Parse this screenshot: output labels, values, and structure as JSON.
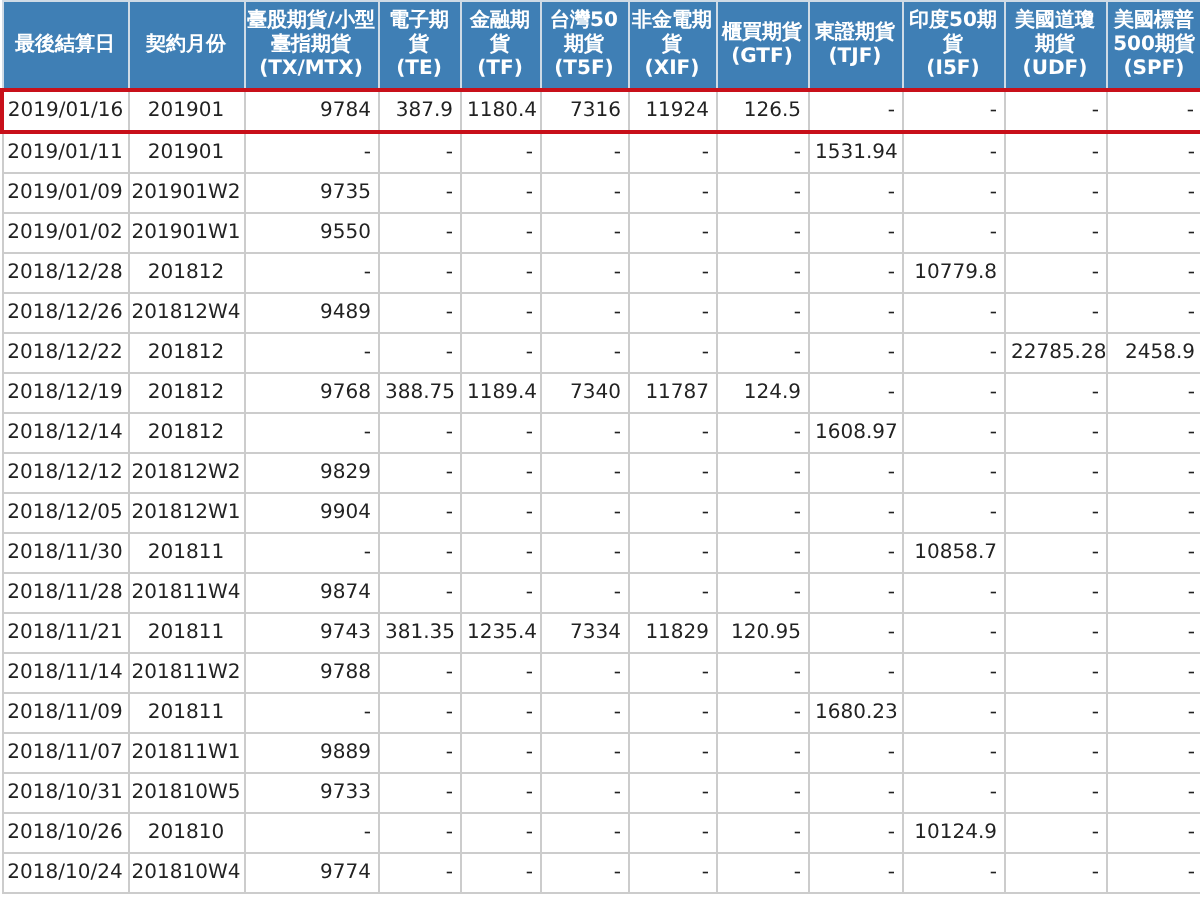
{
  "table": {
    "columns": [
      {
        "name": "最後結算日"
      },
      {
        "name": "契約月份"
      },
      {
        "name": "臺股期貨/小型臺指期貨",
        "code": "(TX/MTX)"
      },
      {
        "name": "電子期貨",
        "code": "(TE)"
      },
      {
        "name": "金融期貨",
        "code": "(TF)"
      },
      {
        "name": "台灣50期貨",
        "code": "(T5F)"
      },
      {
        "name": "非金電期貨",
        "code": "(XIF)"
      },
      {
        "name": "櫃買期貨",
        "code": "(GTF)"
      },
      {
        "name": "東證期貨",
        "code": "(TJF)"
      },
      {
        "name": "印度50期貨",
        "code": "(I5F)"
      },
      {
        "name": "美國道瓊期貨",
        "code": "(UDF)"
      },
      {
        "name": "美國標普500期貨",
        "code": "(SPF)"
      }
    ],
    "rows": [
      {
        "selected": true,
        "cells": [
          "2019/01/16",
          "201901",
          "9784",
          "387.9",
          "1180.4",
          "7316",
          "11924",
          "126.5",
          "-",
          "-",
          "-",
          "-"
        ]
      },
      {
        "selected": false,
        "cells": [
          "2019/01/11",
          "201901",
          "-",
          "-",
          "-",
          "-",
          "-",
          "-",
          "1531.94",
          "-",
          "-",
          "-"
        ]
      },
      {
        "selected": false,
        "cells": [
          "2019/01/09",
          "201901W2",
          "9735",
          "-",
          "-",
          "-",
          "-",
          "-",
          "-",
          "-",
          "-",
          "-"
        ]
      },
      {
        "selected": false,
        "cells": [
          "2019/01/02",
          "201901W1",
          "9550",
          "-",
          "-",
          "-",
          "-",
          "-",
          "-",
          "-",
          "-",
          "-"
        ]
      },
      {
        "selected": false,
        "cells": [
          "2018/12/28",
          "201812",
          "-",
          "-",
          "-",
          "-",
          "-",
          "-",
          "-",
          "10779.8",
          "-",
          "-"
        ]
      },
      {
        "selected": false,
        "cells": [
          "2018/12/26",
          "201812W4",
          "9489",
          "-",
          "-",
          "-",
          "-",
          "-",
          "-",
          "-",
          "-",
          "-"
        ]
      },
      {
        "selected": false,
        "cells": [
          "2018/12/22",
          "201812",
          "-",
          "-",
          "-",
          "-",
          "-",
          "-",
          "-",
          "-",
          "22785.28",
          "2458.9"
        ]
      },
      {
        "selected": false,
        "cells": [
          "2018/12/19",
          "201812",
          "9768",
          "388.75",
          "1189.4",
          "7340",
          "11787",
          "124.9",
          "-",
          "-",
          "-",
          "-"
        ]
      },
      {
        "selected": false,
        "cells": [
          "2018/12/14",
          "201812",
          "-",
          "-",
          "-",
          "-",
          "-",
          "-",
          "1608.97",
          "-",
          "-",
          "-"
        ]
      },
      {
        "selected": false,
        "cells": [
          "2018/12/12",
          "201812W2",
          "9829",
          "-",
          "-",
          "-",
          "-",
          "-",
          "-",
          "-",
          "-",
          "-"
        ]
      },
      {
        "selected": false,
        "cells": [
          "2018/12/05",
          "201812W1",
          "9904",
          "-",
          "-",
          "-",
          "-",
          "-",
          "-",
          "-",
          "-",
          "-"
        ]
      },
      {
        "selected": false,
        "cells": [
          "2018/11/30",
          "201811",
          "-",
          "-",
          "-",
          "-",
          "-",
          "-",
          "-",
          "10858.7",
          "-",
          "-"
        ]
      },
      {
        "selected": false,
        "cells": [
          "2018/11/28",
          "201811W4",
          "9874",
          "-",
          "-",
          "-",
          "-",
          "-",
          "-",
          "-",
          "-",
          "-"
        ]
      },
      {
        "selected": false,
        "cells": [
          "2018/11/21",
          "201811",
          "9743",
          "381.35",
          "1235.4",
          "7334",
          "11829",
          "120.95",
          "-",
          "-",
          "-",
          "-"
        ]
      },
      {
        "selected": false,
        "cells": [
          "2018/11/14",
          "201811W2",
          "9788",
          "-",
          "-",
          "-",
          "-",
          "-",
          "-",
          "-",
          "-",
          "-"
        ]
      },
      {
        "selected": false,
        "cells": [
          "2018/11/09",
          "201811",
          "-",
          "-",
          "-",
          "-",
          "-",
          "-",
          "1680.23",
          "-",
          "-",
          "-"
        ]
      },
      {
        "selected": false,
        "cells": [
          "2018/11/07",
          "201811W1",
          "9889",
          "-",
          "-",
          "-",
          "-",
          "-",
          "-",
          "-",
          "-",
          "-"
        ]
      },
      {
        "selected": false,
        "cells": [
          "2018/10/31",
          "201810W5",
          "9733",
          "-",
          "-",
          "-",
          "-",
          "-",
          "-",
          "-",
          "-",
          "-"
        ]
      },
      {
        "selected": false,
        "cells": [
          "2018/10/26",
          "201810",
          "-",
          "-",
          "-",
          "-",
          "-",
          "-",
          "-",
          "10124.9",
          "-",
          "-"
        ]
      },
      {
        "selected": false,
        "cells": [
          "2018/10/24",
          "201810W4",
          "9774",
          "-",
          "-",
          "-",
          "-",
          "-",
          "-",
          "-",
          "-",
          "-"
        ]
      }
    ]
  }
}
